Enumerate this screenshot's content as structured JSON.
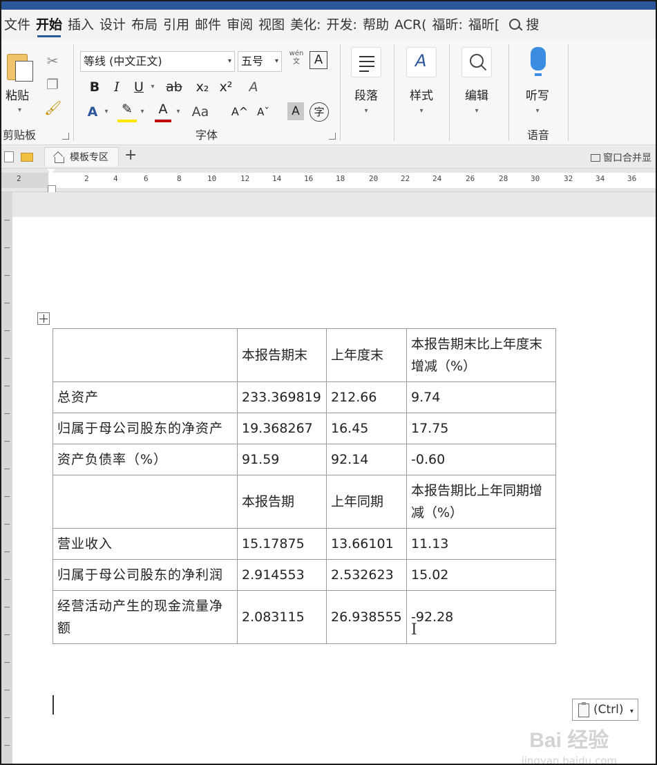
{
  "tabs": [
    "文件",
    "开始",
    "插入",
    "设计",
    "布局",
    "引用",
    "邮件",
    "审阅",
    "视图",
    "美化:",
    "开发:",
    "帮助",
    "ACR(",
    "福昕:",
    "福昕[",
    "搜"
  ],
  "active_tab": "开始",
  "clipboard": {
    "paste_label": "粘贴",
    "group_label": "剪贴板"
  },
  "font": {
    "font_name": "等线 (中文正文)",
    "font_size": "五号",
    "wen": "wén\n文",
    "char_border": "A",
    "bold": "B",
    "italic": "I",
    "underline": "U",
    "strike": "ab",
    "subscript": "x₂",
    "superscript": "x²",
    "clear": "A",
    "text_effect": "A",
    "highlight": "✎",
    "font_color": "A",
    "change_case": "Aa",
    "grow": "A^",
    "shrink": "Aˇ",
    "shading": "A",
    "enclose": "字",
    "group_label": "字体"
  },
  "paragraph": {
    "label": "段落"
  },
  "styles": {
    "label": "样式"
  },
  "editing": {
    "label": "编辑"
  },
  "dictate": {
    "label": "听写",
    "group_label": "语音"
  },
  "docbar": {
    "template_tab": "模板专区",
    "plus": "+",
    "merge": "窗口合并显"
  },
  "ruler": {
    "numbers": [
      "2",
      "2",
      "4",
      "6",
      "8",
      "10",
      "12",
      "14",
      "16",
      "18",
      "20",
      "22",
      "24",
      "26",
      "28",
      "30",
      "32",
      "34",
      "36"
    ]
  },
  "table": {
    "rows": [
      [
        "",
        "本报告期末",
        "上年度末",
        "本报告期末比上年度末增减（%）"
      ],
      [
        "总资产",
        "233.369819",
        "212.66",
        "9.74"
      ],
      [
        "归属于母公司股东的净资产",
        "19.368267",
        "16.45",
        "17.75"
      ],
      [
        "资产负债率（%）",
        "91.59",
        "92.14",
        "-0.60"
      ],
      [
        "",
        "本报告期",
        "上年同期",
        "本报告期比上年同期增减（%）"
      ],
      [
        "营业收入",
        "15.17875",
        "13.66101",
        "11.13"
      ],
      [
        "归属于母公司股东的净利润",
        "2.914553",
        "2.532623",
        "15.02"
      ],
      [
        "经营活动产生的现金流量净额",
        "2.083115",
        "26.938555",
        "-92.28"
      ]
    ]
  },
  "paste_options": "(Ctrl)",
  "watermark": {
    "main": "Bai 经验",
    "sub": "jingyan.baidu.com"
  }
}
